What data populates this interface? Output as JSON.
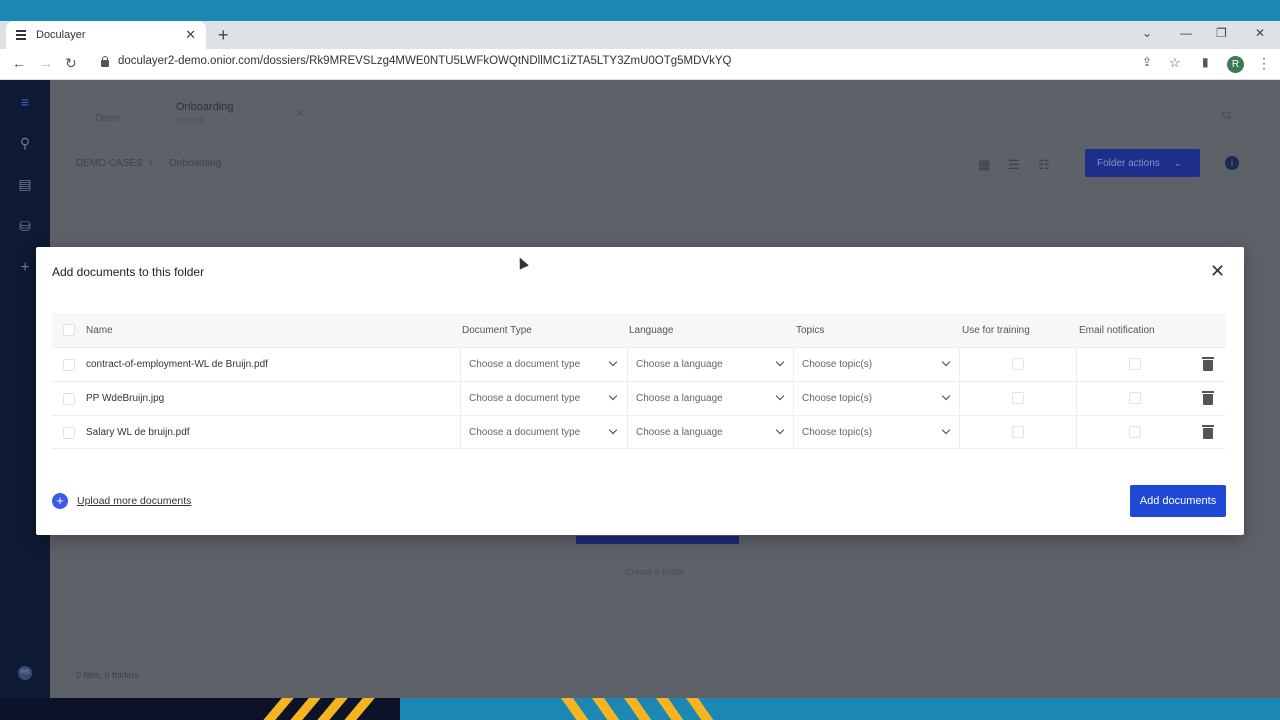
{
  "browser": {
    "tab_title": "Doculayer",
    "url": "doculayer2-demo.onior.com/dossiers/Rk9MREVSLzg4MWE0NTU5LWFkOWQtNDllMC1iZTA5LTY3ZmU0OTg5MDVkYQ",
    "profile_initial": "R"
  },
  "app": {
    "tabs": [
      {
        "label": "Open"
      },
      {
        "label": "Onboarding",
        "sublabel": "FOLDER"
      }
    ],
    "breadcrumb": [
      "DEMO CASES",
      "Onboarding"
    ],
    "folder_actions_label": "Folder actions",
    "create_folder_label": "Create a folder",
    "status_text": "0 files, 0 folders",
    "user_initials": "RS"
  },
  "modal": {
    "title": "Add documents to this folder",
    "columns": {
      "name": "Name",
      "document_type": "Document Type",
      "language": "Language",
      "topics": "Topics",
      "use_for_training": "Use for training",
      "email_notification": "Email notification"
    },
    "rows": [
      {
        "name": "contract-of-employment-WL de Bruijn.pdf",
        "document_type": "Choose a document type",
        "language": "Choose a language",
        "topics": "Choose topic(s)"
      },
      {
        "name": "PP WdeBruijn.jpg",
        "document_type": "Choose a document type",
        "language": "Choose a language",
        "topics": "Choose topic(s)"
      },
      {
        "name": "Salary WL de bruijn.pdf",
        "document_type": "Choose a document type",
        "language": "Choose a language",
        "topics": "Choose topic(s)"
      }
    ],
    "upload_more_label": "Upload more documents",
    "add_documents_label": "Add documents"
  }
}
